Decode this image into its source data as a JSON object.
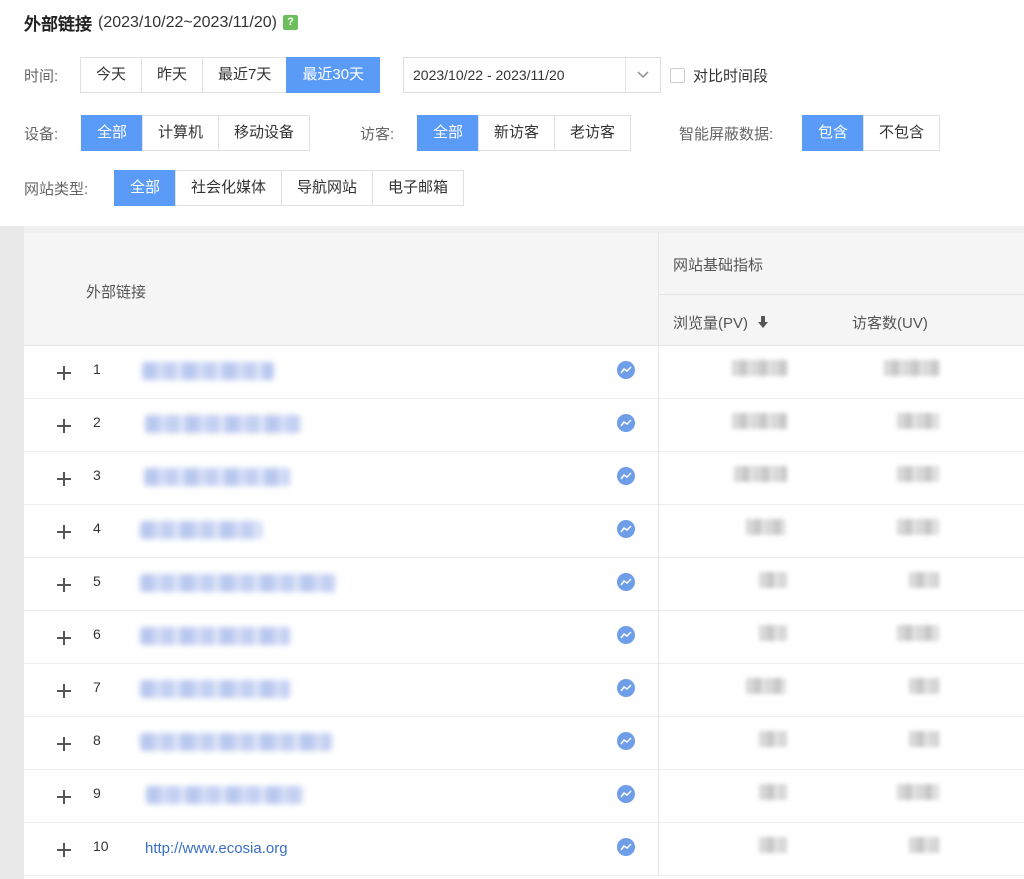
{
  "header": {
    "title": "外部链接",
    "range": "(2023/10/22~2023/11/20)",
    "help_icon_text": "?"
  },
  "filters": {
    "time_label": "时间:",
    "time_options": [
      "今天",
      "昨天",
      "最近7天",
      "最近30天"
    ],
    "time_active": "最近30天",
    "date_range_value": "2023/10/22 - 2023/11/20",
    "compare_label": "对比时间段",
    "device_label": "设备:",
    "device_options": [
      "全部",
      "计算机",
      "移动设备"
    ],
    "visitor_label": "访客:",
    "visitor_options": [
      "全部",
      "新访客",
      "老访客"
    ],
    "smart_label": "智能屏蔽数据:",
    "smart_options": [
      "包含",
      "不包含"
    ],
    "site_type_label": "网站类型:",
    "site_type_options": [
      "全部",
      "社会化媒体",
      "导航网站",
      "电子邮箱"
    ]
  },
  "table": {
    "col_link": "外部链接",
    "group_label": "网站基础指标",
    "col_pv": "浏览量(PV)",
    "col_uv": "访客数(UV)",
    "rows": [
      {
        "num": "1",
        "link": ""
      },
      {
        "num": "2",
        "link": ""
      },
      {
        "num": "3",
        "link": ""
      },
      {
        "num": "4",
        "link": ""
      },
      {
        "num": "5",
        "link": ""
      },
      {
        "num": "6",
        "link": ""
      },
      {
        "num": "7",
        "link": ""
      },
      {
        "num": "8",
        "link": ""
      },
      {
        "num": "9",
        "link": ""
      },
      {
        "num": "10",
        "link": "http://www.ecosia.org"
      }
    ]
  },
  "colors": {
    "accent": "#5b9bf8",
    "link": "#3a6fc4",
    "help": "#6cbf5c"
  }
}
